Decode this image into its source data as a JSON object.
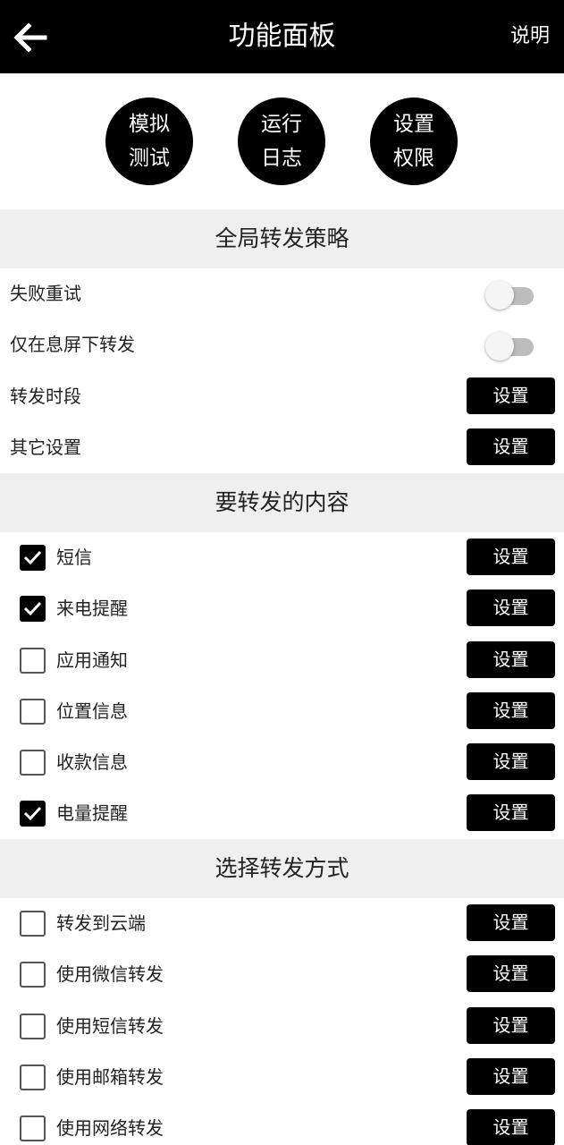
{
  "header": {
    "title": "功能面板",
    "help_label": "说明"
  },
  "quick_actions": [
    {
      "line1": "模拟",
      "line2": "测试"
    },
    {
      "line1": "运行",
      "line2": "日志"
    },
    {
      "line1": "设置",
      "line2": "权限"
    }
  ],
  "global_policy": {
    "title": "全局转发策略",
    "items": [
      {
        "label": "失败重试",
        "control": "toggle",
        "on": false
      },
      {
        "label": "仅在息屏下转发",
        "control": "toggle",
        "on": false
      },
      {
        "label": "转发时段",
        "control": "button",
        "button_label": "设置"
      },
      {
        "label": "其它设置",
        "control": "button",
        "button_label": "设置"
      }
    ]
  },
  "forward_content": {
    "title": "要转发的内容",
    "items": [
      {
        "label": "短信",
        "checked": true,
        "button_label": "设置"
      },
      {
        "label": "来电提醒",
        "checked": true,
        "button_label": "设置"
      },
      {
        "label": "应用通知",
        "checked": false,
        "button_label": "设置"
      },
      {
        "label": "位置信息",
        "checked": false,
        "button_label": "设置"
      },
      {
        "label": "收款信息",
        "checked": false,
        "button_label": "设置"
      },
      {
        "label": "电量提醒",
        "checked": true,
        "button_label": "设置"
      }
    ]
  },
  "forward_method": {
    "title": "选择转发方式",
    "items": [
      {
        "label": "转发到云端",
        "checked": false,
        "button_label": "设置"
      },
      {
        "label": "使用微信转发",
        "checked": false,
        "button_label": "设置"
      },
      {
        "label": "使用短信转发",
        "checked": false,
        "button_label": "设置"
      },
      {
        "label": "使用邮箱转发",
        "checked": false,
        "button_label": "设置"
      },
      {
        "label": "使用网络转发",
        "checked": false,
        "button_label": "设置"
      }
    ]
  },
  "colors": {
    "topbar": "#000000",
    "section_bg": "#efefef",
    "button": "#000000",
    "toggle_off_track": "#bdbdbd"
  }
}
